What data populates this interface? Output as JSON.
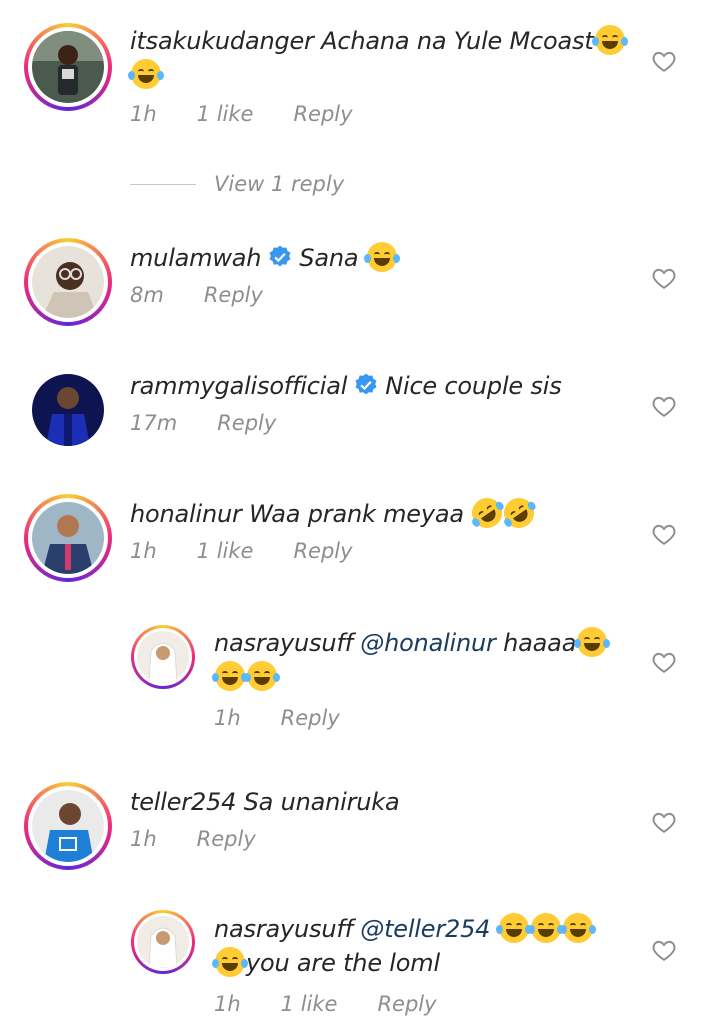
{
  "comments": [
    {
      "username": "itsakukudanger",
      "text": "Achana na Yule Mcoast",
      "time": "1h",
      "likes": "1 like",
      "reply_label": "Reply",
      "view_replies": "View 1 reply"
    },
    {
      "username": "mulamwah",
      "verified": true,
      "text": "Sana",
      "time": "8m",
      "reply_label": "Reply"
    },
    {
      "username": "rammygalisofficial",
      "verified": true,
      "text": "Nice couple sis",
      "time": "17m",
      "reply_label": "Reply"
    },
    {
      "username": "honalinur",
      "text": "Waa prank meyaa",
      "time": "1h",
      "likes": "1 like",
      "reply_label": "Reply"
    },
    {
      "username": "nasrayusuff",
      "mention": "@honalinur",
      "text": "haaaa",
      "time": "1h",
      "reply_label": "Reply"
    },
    {
      "username": "teller254",
      "text": "Sa unaniruka",
      "time": "1h",
      "reply_label": "Reply"
    },
    {
      "username": "nasrayusuff",
      "mention": "@teller254",
      "text": "you are the loml",
      "time": "1h",
      "likes": "1 like",
      "reply_label": "Reply"
    }
  ],
  "icons": {
    "like": "heart-outline-icon",
    "verified": "verified-badge-icon",
    "emoji_laugh": "face-with-tears-of-joy",
    "emoji_rofl": "rolling-on-floor-laughing"
  },
  "colors": {
    "username": "#262626",
    "meta": "#8e8e8e",
    "mention": "#1b3c61",
    "verified": "#3897f0",
    "story_ring": "#ee2a7b"
  }
}
